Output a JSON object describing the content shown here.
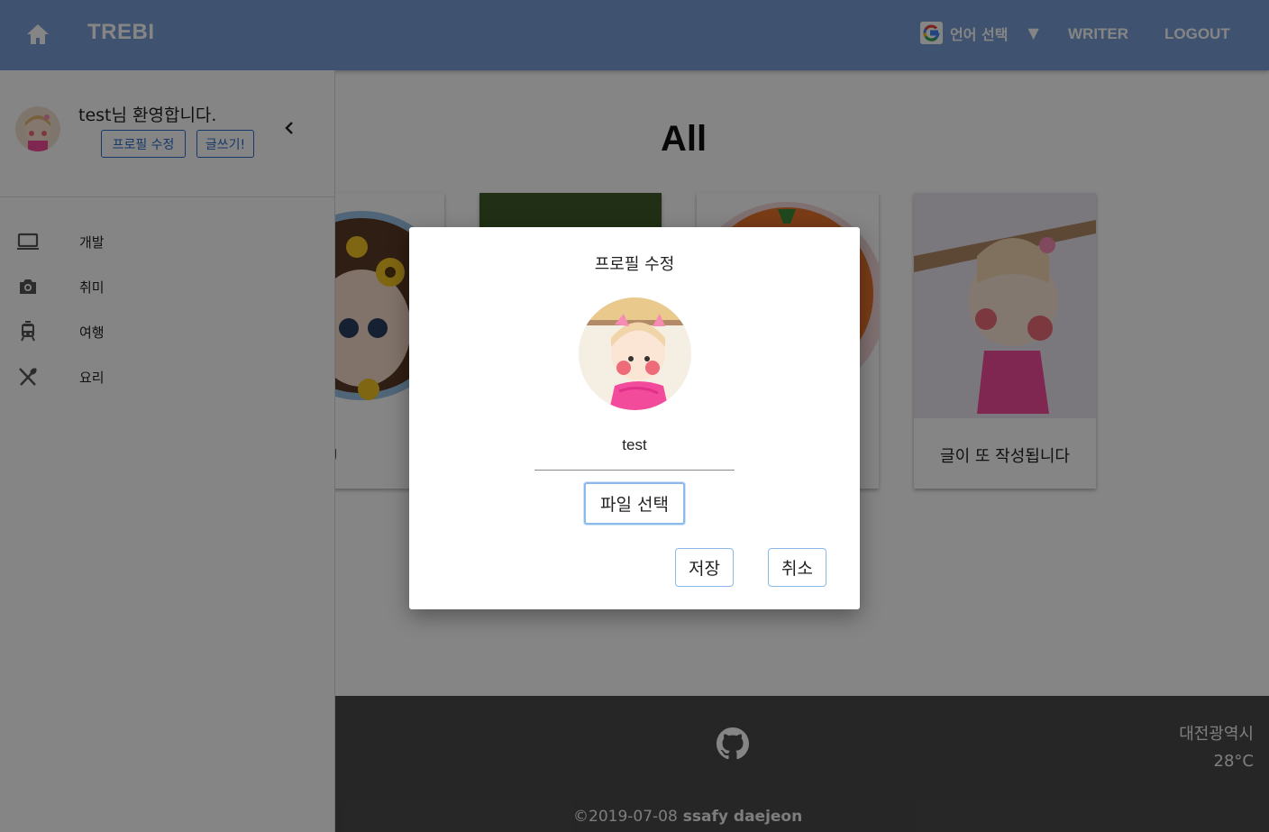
{
  "appbar": {
    "brand": "TREBI",
    "language_label": "언어 선택",
    "language_caret": "▼",
    "writer_label": "WRITER",
    "logout_label": "LOGOUT",
    "color": "#7aa0d6"
  },
  "main": {
    "title": "All",
    "cards": [
      {
        "caption": "g"
      },
      {
        "caption": ""
      },
      {
        "caption": ""
      },
      {
        "caption": "글이 또 작성됩니다"
      }
    ]
  },
  "drawer": {
    "welcome": "test님 환영합니다.",
    "edit_profile_label": "프로필 수정",
    "write_label": "글쓰기!",
    "menu": [
      {
        "label": "개발",
        "icon": "laptop-icon"
      },
      {
        "label": "취미",
        "icon": "camera-icon"
      },
      {
        "label": "여행",
        "icon": "train-icon"
      },
      {
        "label": "요리",
        "icon": "utensils-icon"
      }
    ]
  },
  "dialog": {
    "title": "프로필 수정",
    "name_value": "test",
    "file_button_label": "파일 선택",
    "save_label": "저장",
    "cancel_label": "취소"
  },
  "footer": {
    "copyright": "©2019-07-08",
    "organization": "ssafy daejeon",
    "city": "대전광역시",
    "temperature": "28°C"
  }
}
